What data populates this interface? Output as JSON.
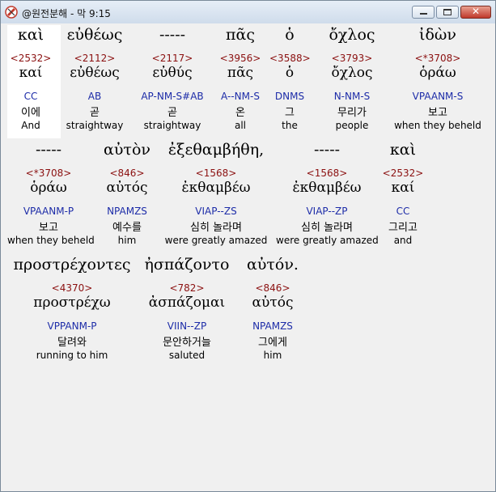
{
  "window": {
    "title": "@원전분해 - 막 9:15"
  },
  "rows": [
    [
      {
        "g": "καὶ",
        "n": "<2532>",
        "l": "καί",
        "m": "CC",
        "k": "이에",
        "e": "And"
      },
      {
        "g": "εὐθέως",
        "n": "<2112>",
        "l": "εὐθέως",
        "m": "AB",
        "k": "곧",
        "e": "straightway"
      },
      {
        "g": "-----",
        "n": "<2117>",
        "l": "εὐθύς",
        "m": "AP-NM-S#AB",
        "k": "곧",
        "e": "straightway"
      },
      {
        "g": "πᾶς",
        "n": "<3956>",
        "l": "πᾶς",
        "m": "A--NM-S",
        "k": "온",
        "e": "all"
      },
      {
        "g": "ὁ",
        "n": "<3588>",
        "l": "ὁ",
        "m": "DNMS",
        "k": "그",
        "e": "the"
      },
      {
        "g": "ὄχλος",
        "n": "<3793>",
        "l": "ὄχλος",
        "m": "N-NM-S",
        "k": "무리가",
        "e": "people"
      },
      {
        "g": "ἰδὼν",
        "n": "<*3708>",
        "l": "ὁράω",
        "m": "VPAANM-S",
        "k": "보고",
        "e": "when they beheld"
      }
    ],
    [
      {
        "g": "-----",
        "n": "<*3708>",
        "l": "ὁράω",
        "m": "VPAANM-P",
        "k": "보고",
        "e": "when they beheld"
      },
      {
        "g": "αὐτὸν",
        "n": "<846>",
        "l": "αὐτός",
        "m": "NPAMZS",
        "k": "예수를",
        "e": "him"
      },
      {
        "g": "ἐξεθαμβήθη,",
        "n": "<1568>",
        "l": "ἐκθαμβέω",
        "m": "VIAP--ZS",
        "k": "심히 놀라며",
        "e": "were greatly amazed"
      },
      {
        "g": "-----",
        "n": "<1568>",
        "l": "ἐκθαμβέω",
        "m": "VIAP--ZP",
        "k": "심히 놀라며",
        "e": "were greatly amazed"
      },
      {
        "g": "καὶ",
        "n": "<2532>",
        "l": "καί",
        "m": "CC",
        "k": "그리고",
        "e": "and"
      }
    ],
    [
      {
        "g": "προστρέχοντες",
        "n": "<4370>",
        "l": "προστρέχω",
        "m": "VPPANM-P",
        "k": "달려와",
        "e": "running to him"
      },
      {
        "g": "ἠσπάζοντο",
        "n": "<782>",
        "l": "ἀσπάζομαι",
        "m": "VIIN--ZP",
        "k": "문안하거늘",
        "e": "saluted"
      },
      {
        "g": "αὐτόν.",
        "n": "<846>",
        "l": "αὐτός",
        "m": "NPAMZS",
        "k": "그에게",
        "e": "him"
      }
    ]
  ]
}
